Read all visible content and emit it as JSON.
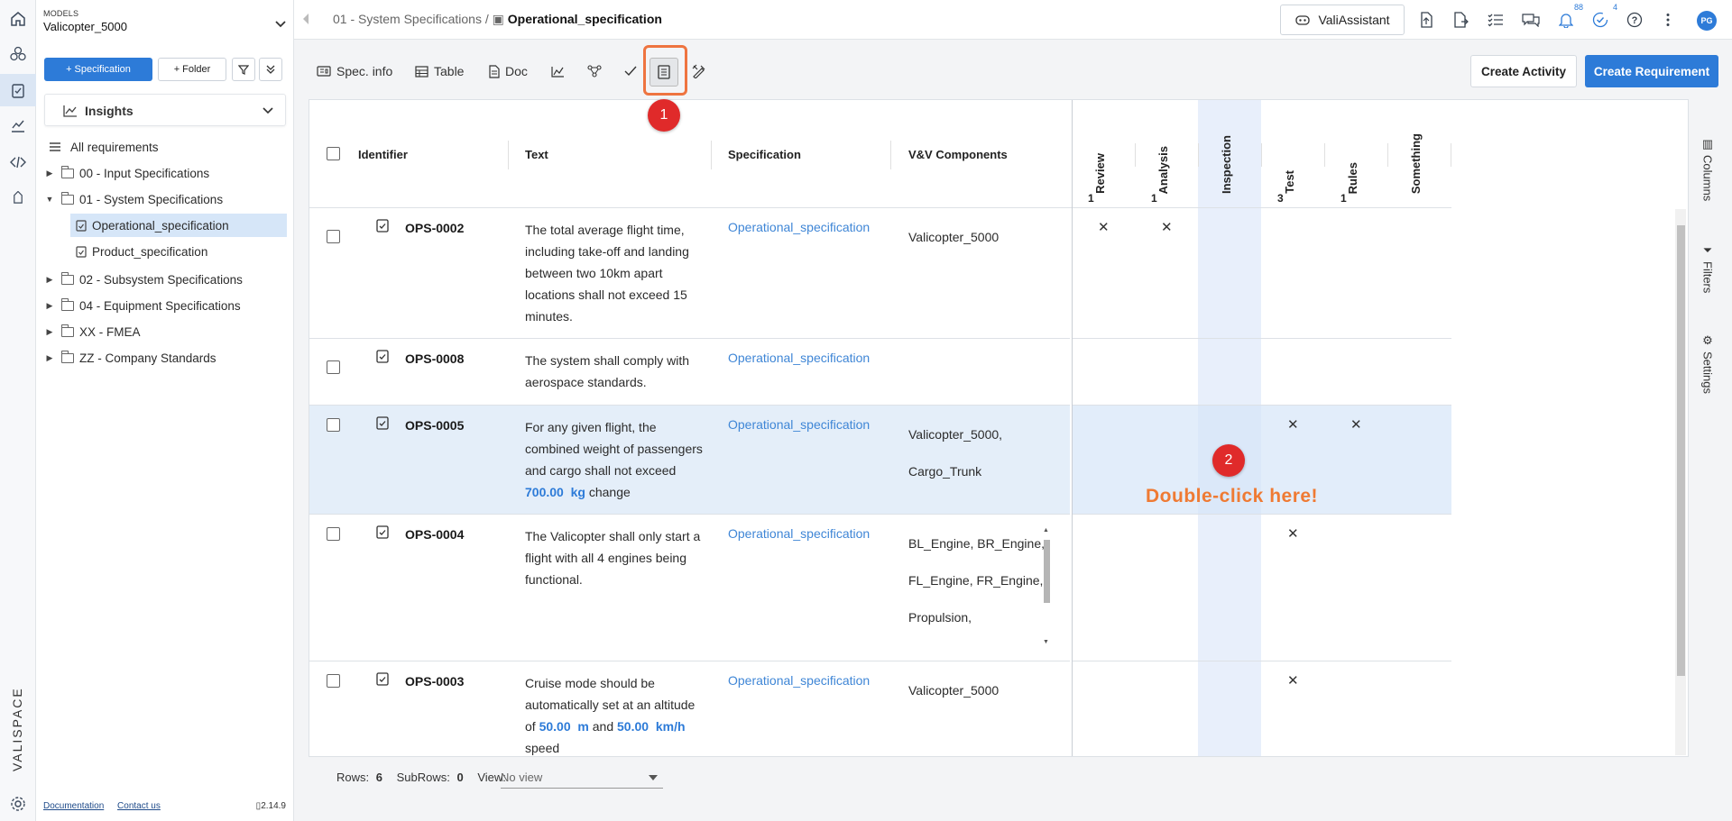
{
  "sidebar": {
    "model_caption": "MODELS",
    "model_name": "Valicopter_5000",
    "btn_specification": "Specification",
    "btn_folder": "Folder",
    "insights": "Insights",
    "tree": [
      {
        "label": "All requirements"
      },
      {
        "label": "00 - Input Specifications"
      },
      {
        "label": "01 - System Specifications"
      },
      {
        "label": "Operational_specification"
      },
      {
        "label": "Product_specification"
      },
      {
        "label": "02 - Subsystem Specifications"
      },
      {
        "label": "04 - Equipment Specifications"
      },
      {
        "label": "XX - FMEA"
      },
      {
        "label": "ZZ - Company Standards"
      }
    ],
    "footer": {
      "documentation": "Documentation",
      "contact": "Contact us",
      "version": "2.14.9"
    },
    "brand": "VALISPACE"
  },
  "header": {
    "breadcrumb_parent": "01 - System Specifications /",
    "breadcrumb_current": "Operational_specification",
    "valiassistant": "ValiAssistant",
    "notifications_count": "88",
    "tasks_count": "4",
    "avatar": "PG"
  },
  "toolbar": {
    "spec_info": "Spec. info",
    "table": "Table",
    "doc": "Doc",
    "create_activity": "Create Activity",
    "create_requirement": "Create Requirement"
  },
  "grid": {
    "headers": {
      "identifier": "Identifier",
      "text": "Text",
      "specification": "Specification",
      "components": "V&V Components"
    },
    "vv_columns": [
      {
        "name": "Review",
        "count": "1"
      },
      {
        "name": "Analysis",
        "count": "1"
      },
      {
        "name": "Inspection",
        "count": ""
      },
      {
        "name": "Test",
        "count": "3"
      },
      {
        "name": "Rules",
        "count": "1"
      },
      {
        "name": "Something",
        "count": ""
      }
    ],
    "rows": [
      {
        "id": "OPS-0002",
        "text": "The total average flight time, including take-off and landing between two 10km apart locations shall not exceed 15 minutes.",
        "spec": "Operational_specification",
        "components": "Valicopter_5000"
      },
      {
        "id": "OPS-0008",
        "text": "The system shall comply with aerospace standards.",
        "spec": "Operational_specification",
        "components": ""
      },
      {
        "id": "OPS-0005",
        "text_a": "For any given flight, the combined weight of passengers and cargo shall not exceed ",
        "text_hl1": "700.00",
        "text_hl2": "kg",
        "text_b": " change",
        "spec": "Operational_specification",
        "components_1": "Valicopter_5000,",
        "components_2": "Cargo_Trunk"
      },
      {
        "id": "OPS-0004",
        "text": "The Valicopter shall only start a flight with all 4 engines being functional.",
        "spec": "Operational_specification",
        "components_1": "BL_Engine, BR_Engine,",
        "components_2": "FL_Engine, FR_Engine,",
        "components_3": "Propulsion,"
      },
      {
        "id": "OPS-0003",
        "text_a": "Cruise mode should be automatically set at an altitude of ",
        "text_hl1": "50.00",
        "text_hl1u": "m",
        "text_mid": " and ",
        "text_hl2": "50.00",
        "text_hl2u": "km/h",
        "text_b": " speed",
        "spec": "Operational_specification",
        "components": "Valicopter_5000"
      }
    ],
    "side_tabs": {
      "columns": "Columns",
      "filters": "Filters",
      "settings": "Settings"
    }
  },
  "footer": {
    "rows_label": "Rows:",
    "rows_value": "6",
    "subrows_label": "SubRows:",
    "subrows_value": "0",
    "view_label": "View:",
    "view_value": "No view"
  },
  "annotations": {
    "marker1": "1",
    "marker2": "2",
    "hint": "Double-click here!"
  },
  "colors": {
    "primary": "#2d7bd8",
    "highlight": "#ee7440",
    "marker": "#e02a2a"
  }
}
